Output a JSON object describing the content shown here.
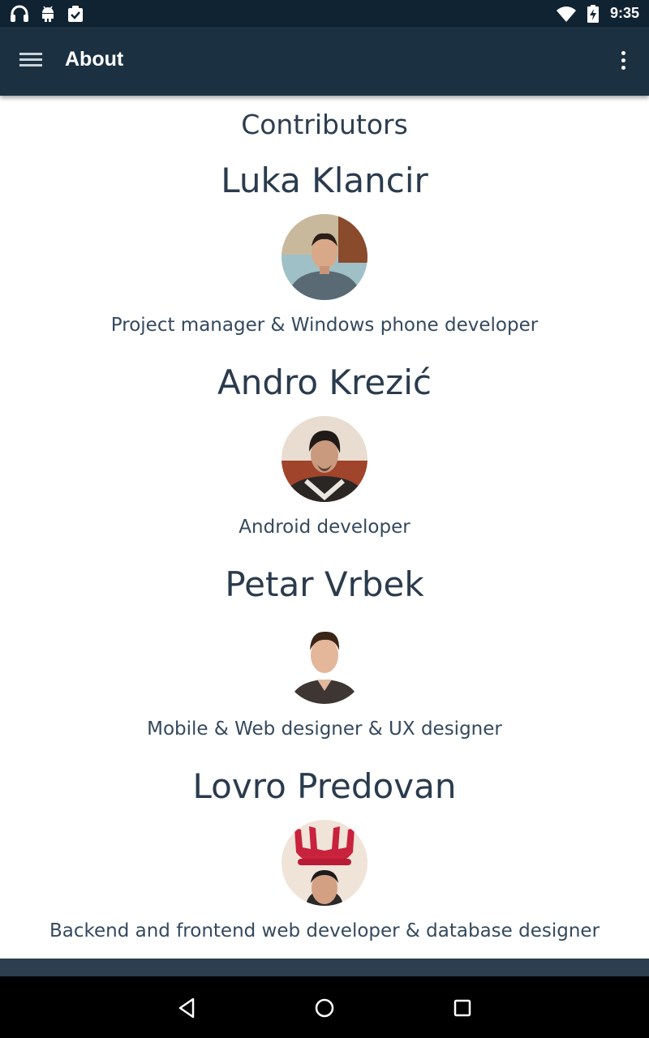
{
  "status_bar": {
    "time": "9:35",
    "icons": [
      "headphones-icon",
      "android-icon",
      "clipboard-check-icon",
      "wifi-icon",
      "battery-charging-icon"
    ]
  },
  "app_bar": {
    "title": "About",
    "menu_icon": "hamburger-menu-icon",
    "overflow_icon": "more-vert-icon"
  },
  "contributors_title": "Contributors",
  "contributors": [
    {
      "name": "Luka Klancir",
      "role": "Project manager & Windows phone developer"
    },
    {
      "name": "Andro Krezić",
      "role": "Android developer"
    },
    {
      "name": "Petar Vrbek",
      "role": "Mobile & Web designer & UX designer"
    },
    {
      "name": "Lovro Predovan",
      "role": "Backend and frontend web developer & database designer"
    }
  ],
  "nav_bar": {
    "buttons": [
      "back-icon",
      "home-icon",
      "recents-icon"
    ]
  }
}
